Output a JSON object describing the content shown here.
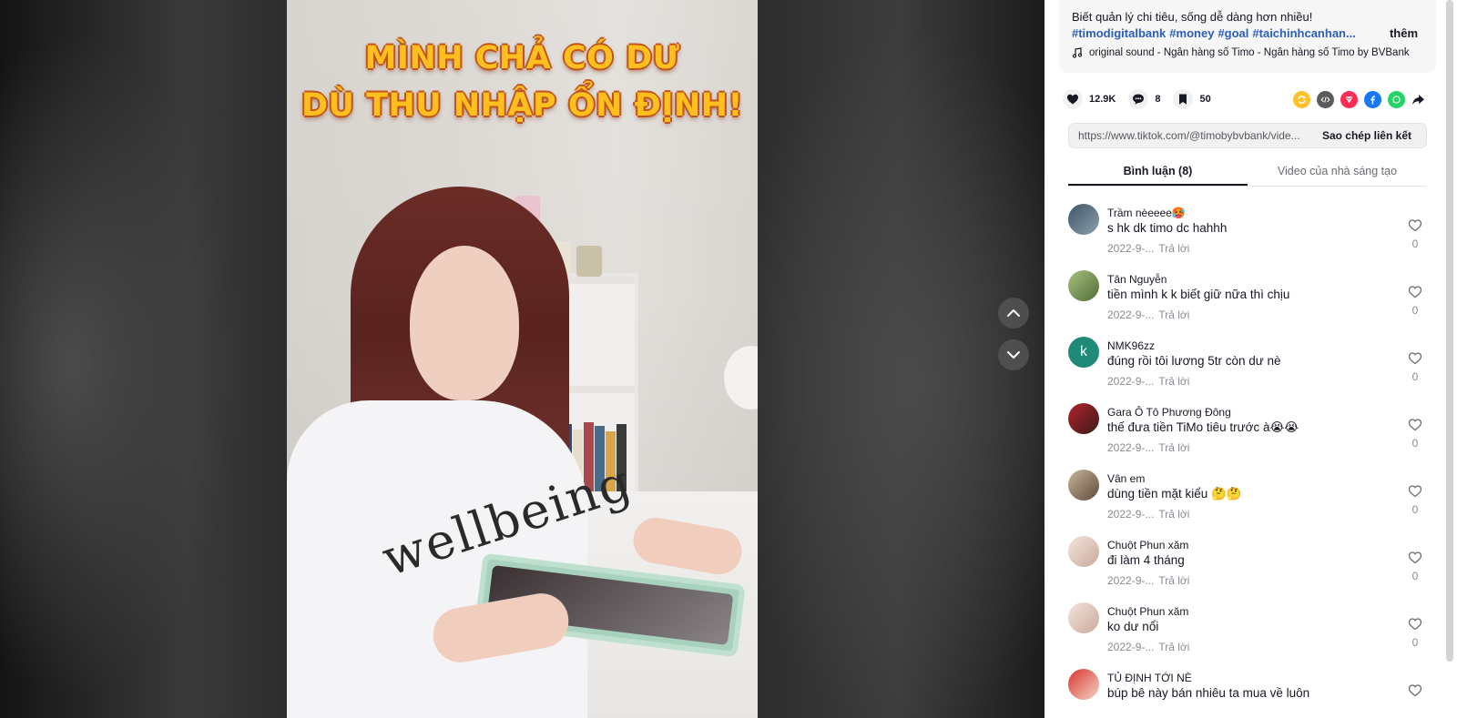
{
  "video": {
    "caption_line1": "MÌNH CHẢ CÓ DƯ",
    "caption_line2": "DÙ THU NHẬP ỔN ĐỊNH!",
    "shirt_print": "wellbeing"
  },
  "nav": {
    "up_icon": "chevron-up-icon",
    "down_icon": "chevron-down-icon"
  },
  "description": {
    "text": "Biết quản lý chi tiêu, sống dễ dàng hơn nhiều!",
    "hashtags": [
      "#timodigitalbank",
      "#money",
      "#goal",
      "#taichinhcanhan..."
    ],
    "more_label": "thêm",
    "sound": "original sound - Ngân hàng số Timo - Ngân hàng số Timo by BVBank"
  },
  "actions": {
    "likes": "12.9K",
    "comments": "8",
    "saves": "50"
  },
  "share_colors": {
    "repost": "#fdc12c",
    "embed": "#5b5b5f",
    "send": "#fe2c55",
    "facebook": "#1877f2",
    "whatsapp": "#25d366"
  },
  "link": {
    "url": "https://www.tiktok.com/@timobybvbank/vide...",
    "copy_label": "Sao chép liên kết"
  },
  "tabs": [
    {
      "label": "Bình luận (8)",
      "active": true
    },
    {
      "label": "Video của nhà sáng tạo",
      "active": false
    }
  ],
  "comments": [
    {
      "user": "Trầm nèeeee🥵",
      "text": "s hk dk timo dc hahhh",
      "date": "2022-9-...",
      "reply": "Trả lời",
      "likes": "0",
      "avatar_color": "#6b7c8a"
    },
    {
      "user": "Tân Nguyễn",
      "text": "tiền mình k k biết giữ nữa thì chịu",
      "date": "2022-9-...",
      "reply": "Trả lời",
      "likes": "0",
      "avatar_color": "#7d9a5e"
    },
    {
      "user": "NMK96zz",
      "text": "đúng rồi tôi lương 5tr còn dư nè",
      "date": "2022-9-...",
      "reply": "Trả lời",
      "likes": "0",
      "avatar_letter": "k",
      "avatar_color": "#1f8a78"
    },
    {
      "user": "Gara Ô Tô Phương Đông",
      "text": "thế đưa tiền TiMo tiêu trước à😭😭",
      "date": "2022-9-...",
      "reply": "Trả lời",
      "likes": "0",
      "avatar_color": "#9b2a2a"
    },
    {
      "user": "Vân em",
      "text": "dùng tiền mặt kiểu 🤔🤔",
      "date": "2022-9-...",
      "reply": "Trả lời",
      "likes": "0",
      "avatar_color": "#8c7a66"
    },
    {
      "user": "Chuột Phun xăm",
      "text": "đi làm 4 tháng",
      "date": "2022-9-...",
      "reply": "Trả lời",
      "likes": "0",
      "avatar_color": "#e9d6cc"
    },
    {
      "user": "Chuột Phun xăm",
      "text": "ko dư nổi",
      "date": "2022-9-...",
      "reply": "Trả lời",
      "likes": "0",
      "avatar_color": "#e9d6cc"
    },
    {
      "user": "TỦ ĐỊNH TỚI NÈ",
      "text": "búp bê này bán nhiêu ta mua về luôn",
      "date": "",
      "reply": "",
      "likes": "",
      "avatar_color": "#c8302a"
    }
  ]
}
